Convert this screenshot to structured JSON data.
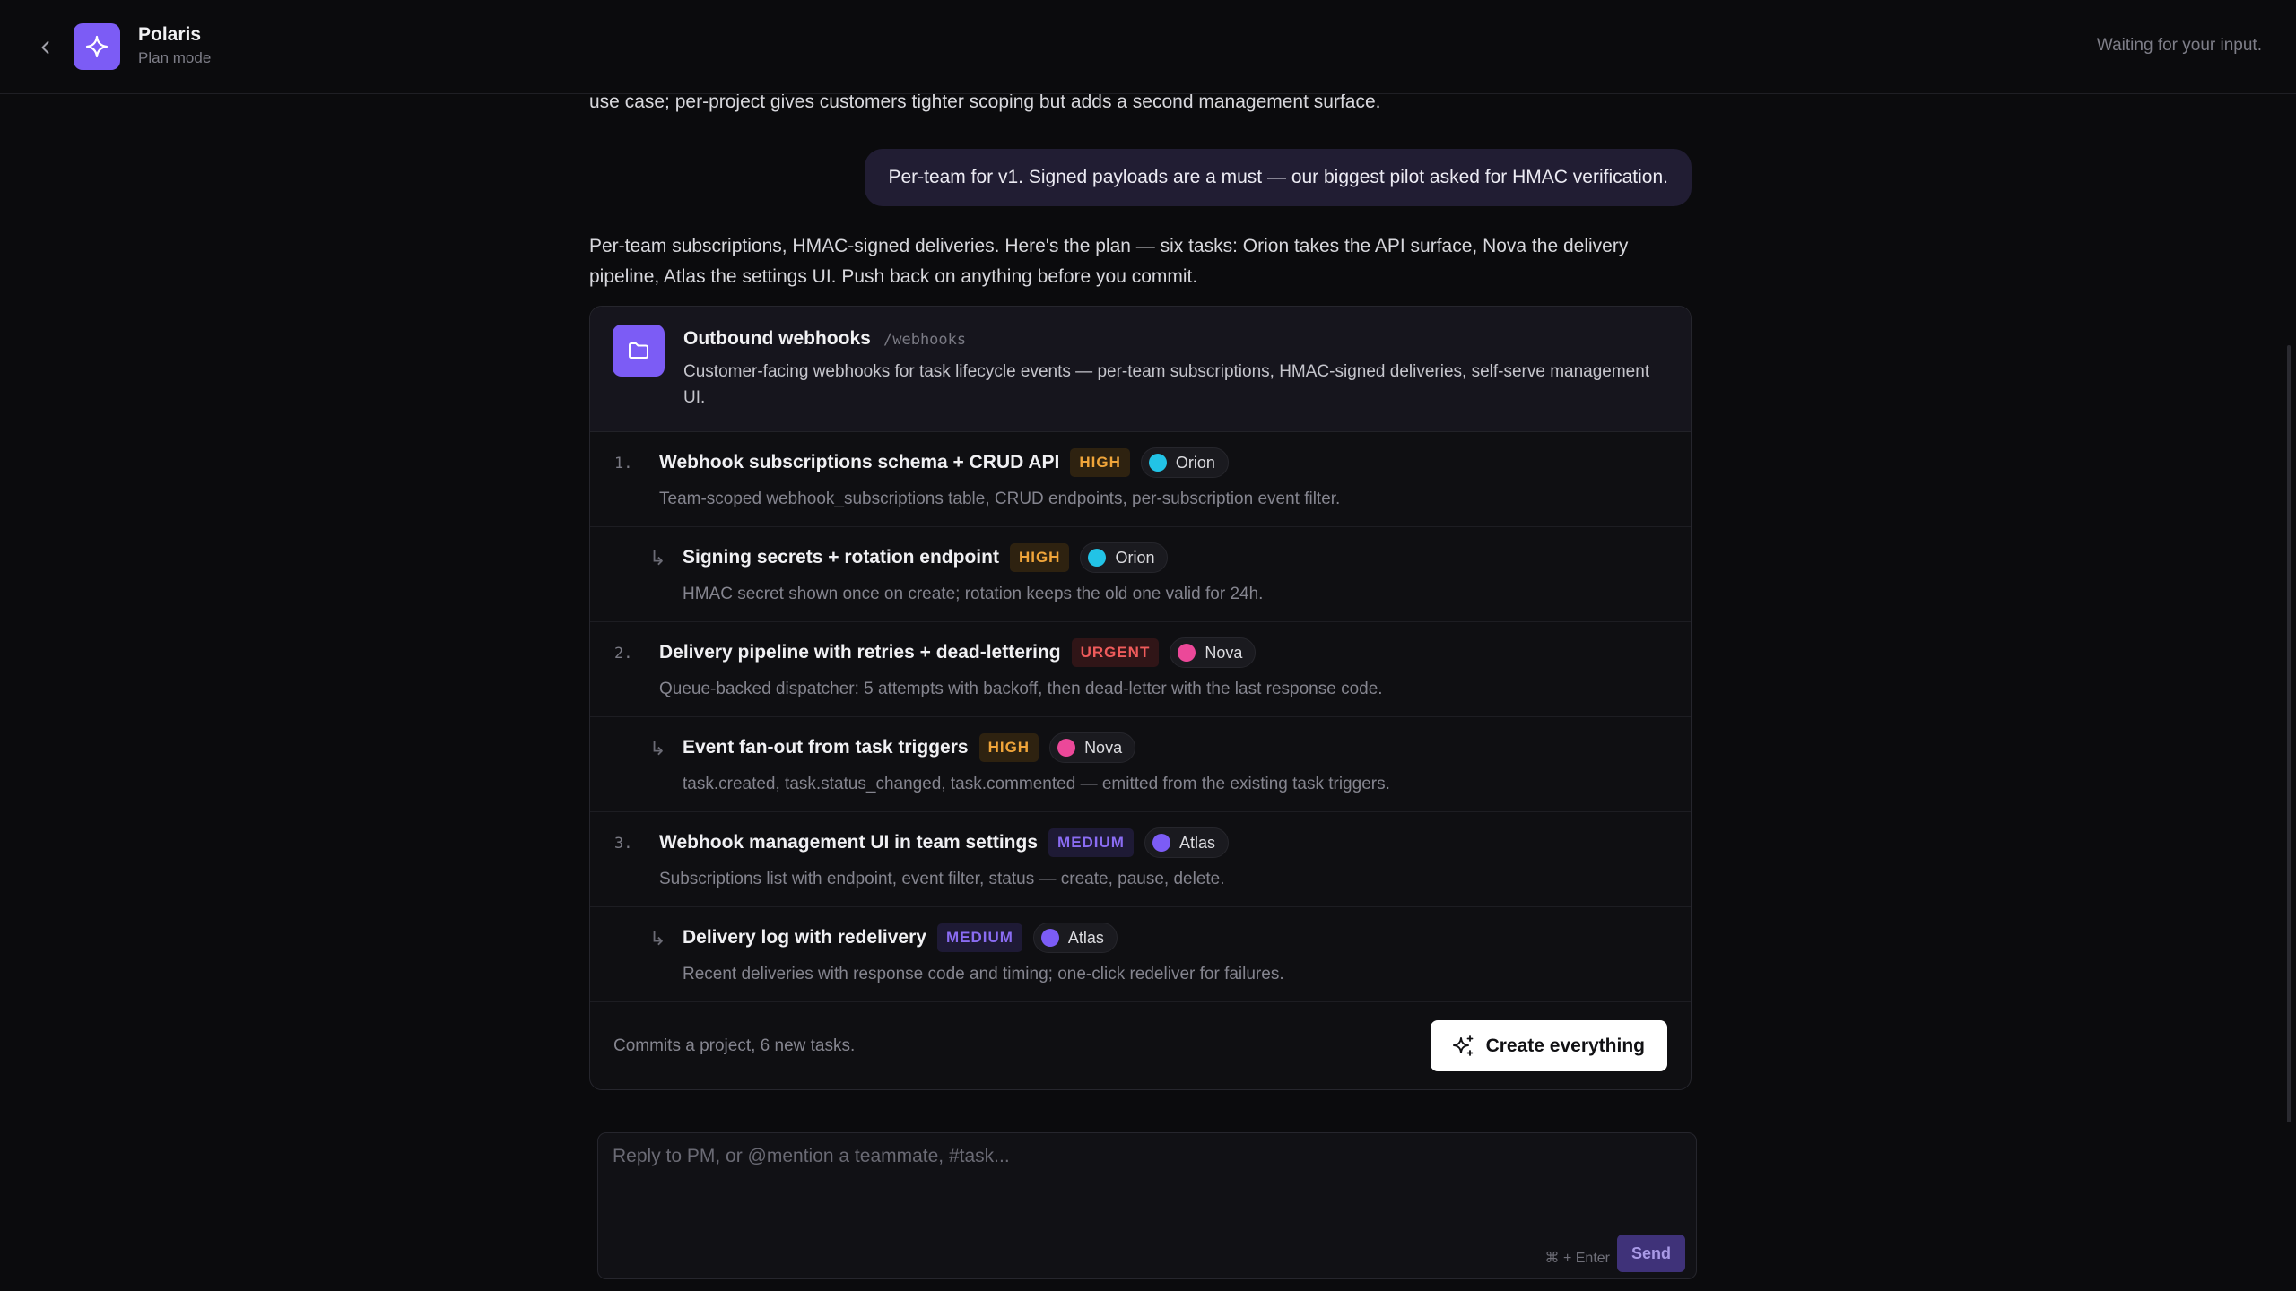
{
  "header": {
    "title": "Polaris",
    "subtitle": "Plan mode",
    "status": "Waiting for your input."
  },
  "chat": {
    "previous_text_tail": "use case; per-project gives customers tighter scoping but adds a second management surface.",
    "user_message": "Per-team for v1. Signed payloads are a must — our biggest pilot asked for HMAC verification.",
    "assistant_message": "Per-team subscriptions, HMAC-signed deliveries. Here's the plan — six tasks: Orion takes the API surface, Nova the delivery pipeline, Atlas the settings UI. Push back on anything before you commit."
  },
  "plan": {
    "project": {
      "name": "Outbound webhooks",
      "slug": "/webhooks",
      "description": "Customer-facing webhooks for task lifecycle events — per-team subscriptions, HMAC-signed deliveries, self-serve management UI."
    },
    "tasks": [
      {
        "number": "1.",
        "title": "Webhook subscriptions schema + CRUD API",
        "priority": "HIGH",
        "assignee": "Orion",
        "assignee_color": "#22c3e6",
        "description": "Team-scoped webhook_subscriptions table, CRUD endpoints, per-subscription event filter."
      },
      {
        "arrow": "↳",
        "title": "Signing secrets + rotation endpoint",
        "priority": "HIGH",
        "assignee": "Orion",
        "assignee_color": "#22c3e6",
        "description": "HMAC secret shown once on create; rotation keeps the old one valid for 24h."
      },
      {
        "number": "2.",
        "title": "Delivery pipeline with retries + dead-lettering",
        "priority": "URGENT",
        "assignee": "Nova",
        "assignee_color": "#ec4899",
        "description": "Queue-backed dispatcher: 5 attempts with backoff, then dead-letter with the last response code."
      },
      {
        "arrow": "↳",
        "title": "Event fan-out from task triggers",
        "priority": "HIGH",
        "assignee": "Nova",
        "assignee_color": "#ec4899",
        "description": "task.created, task.status_changed, task.commented — emitted from the existing task triggers."
      },
      {
        "number": "3.",
        "title": "Webhook management UI in team settings",
        "priority": "MEDIUM",
        "assignee": "Atlas",
        "assignee_color": "#7c5cf5",
        "description": "Subscriptions list with endpoint, event filter, status — create, pause, delete."
      },
      {
        "arrow": "↳",
        "title": "Delivery log with redelivery",
        "priority": "MEDIUM",
        "assignee": "Atlas",
        "assignee_color": "#7c5cf5",
        "description": "Recent deliveries with response code and timing; one-click redeliver for failures."
      }
    ],
    "footer_note": "Commits a project, 6 new tasks.",
    "create_label": "Create everything"
  },
  "composer": {
    "placeholder": "Reply to PM, or @mention a teammate, #task...",
    "shortcut": "⌘ + Enter",
    "send_label": "Send"
  },
  "icons": {
    "back": "chevron-left-icon",
    "logo": "sparkle-icon",
    "folder": "folder-icon",
    "create": "sparkles-icon"
  },
  "colors": {
    "accent": "#7c5cf5",
    "high": "#f0a53a",
    "urgent": "#ef5b5b",
    "medium": "#8a6cf2"
  }
}
